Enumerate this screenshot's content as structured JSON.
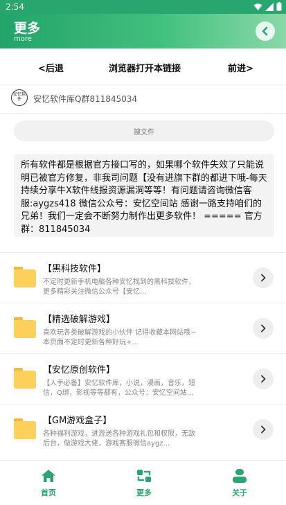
{
  "status_bar": {
    "time": "2:54"
  },
  "app_bar": {
    "title": "更多",
    "subtitle": "more"
  },
  "browser_nav": {
    "back": "<后退",
    "open_in_browser": "浏览器打开本链接",
    "forward": "前进>"
  },
  "group": {
    "logo_text": "安忆软件",
    "label": "安忆软件库Q群811845034"
  },
  "search": {
    "placeholder": "搜文件"
  },
  "notice": "所有软件都是根据官方接口写的，如果哪个软件失效了只能说明已被官方修复，非我司问题【没有进旗下群的都进下哦-每天持续分享牛X软件线报资源漏洞等等！有问题请咨询微信客服:aygzs418 微信公众号：安忆空间站 感谢一路支持咱们的兄弟！我们一定会不断努力制作出更多软件！ ===== 官方群：811845034",
  "items": [
    {
      "name": "【黑科技软件】",
      "desc": "不定时更新手机电脑各种安忆找到的黑科技软件，更多精彩关注微信公众号【安忆..."
    },
    {
      "name": "【精选破解游戏】",
      "desc": "喜欢玩各类破解游戏的小伙伴 记得收藏本网站哦~本页面不定时更新各种好玩+..."
    },
    {
      "name": "【安忆原创软件】",
      "desc": "【人手必备】安忆软件库，小说，漫画，音乐，短信，Q绑，影视等等都有，公众号：安忆空间站..."
    },
    {
      "name": "【GM游戏盒子】",
      "desc": "各种福利游戏，进游送各种游戏礼包和权限，无敌后台，做游戏大佬，游戏客服微信aygz..."
    }
  ],
  "tabbar": {
    "home": "首页",
    "more": "更多",
    "about": "关于"
  },
  "colors": {
    "accent": "#27a66f",
    "folder": "#fcd15b"
  }
}
